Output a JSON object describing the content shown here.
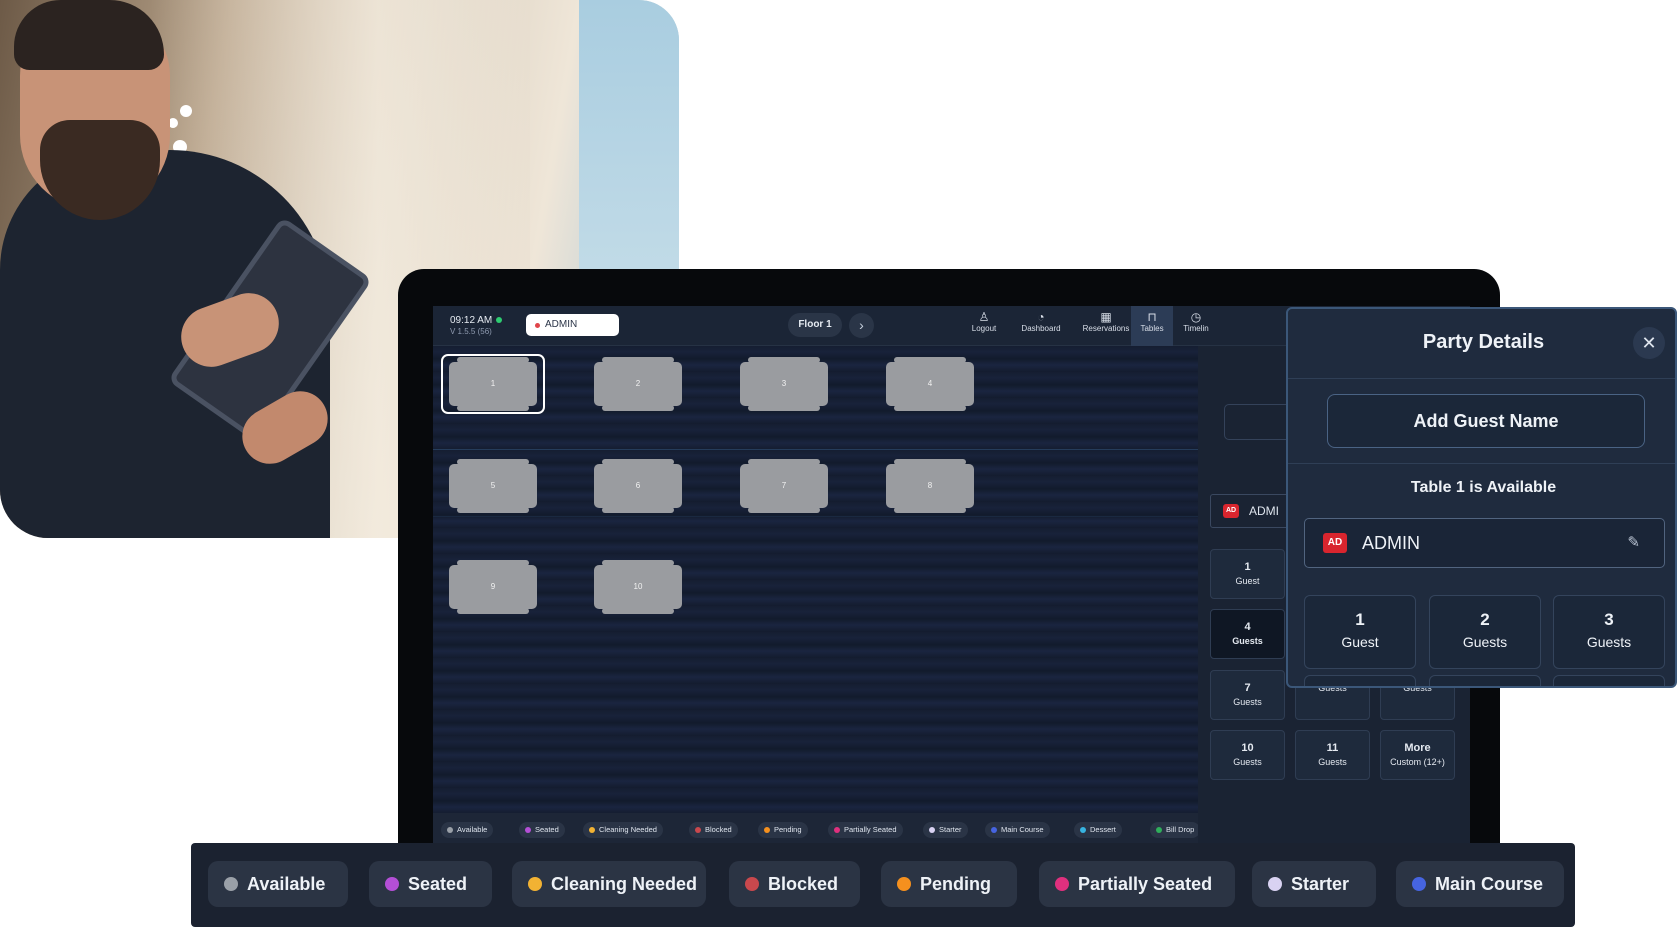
{
  "topbar": {
    "time": "09:12 AM",
    "version": "V 1.5.5 (56)",
    "user": "ADMIN",
    "floor": "Floor 1",
    "nav": [
      {
        "label": "Logout",
        "icon": "user-icon"
      },
      {
        "label": "Dashboard",
        "icon": "dashboard-icon"
      },
      {
        "label": "Reservations",
        "icon": "reservations-icon"
      },
      {
        "label": "Tables",
        "icon": "tables-icon"
      },
      {
        "label": "Timelin",
        "icon": "clock-icon"
      }
    ]
  },
  "tables": [
    {
      "label": "1",
      "status": "selected"
    },
    {
      "label": "2"
    },
    {
      "label": "3"
    },
    {
      "label": "4"
    },
    {
      "label": "5"
    },
    {
      "label": "6"
    },
    {
      "label": "7"
    },
    {
      "label": "8"
    },
    {
      "label": "9"
    },
    {
      "label": "10"
    }
  ],
  "mini_legend": [
    "Available",
    "Seated",
    "Cleaning Needed",
    "Blocked",
    "Pending",
    "Partially Seated",
    "Starter",
    "Main Course",
    "Dessert",
    "Bill Drop"
  ],
  "side_panel": {
    "staff": "ADMI",
    "staff_badge": "AD",
    "guest_options": [
      {
        "n": "1",
        "label": "Guest"
      },
      {
        "n": "4",
        "label": "Guests"
      },
      {
        "n": "7",
        "label": "Guests"
      },
      {
        "n": "",
        "label": "Guests"
      },
      {
        "n": "",
        "label": "Guests"
      },
      {
        "n": "10",
        "label": "Guests"
      },
      {
        "n": "11",
        "label": "Guests"
      },
      {
        "n": "More",
        "label": "Custom (12+)"
      }
    ]
  },
  "party": {
    "title": "Party Details",
    "close_icon": "close-icon",
    "add_guest": "Add Guest Name",
    "status": "Table 1 is Available",
    "staff_badge": "AD",
    "staff_name": "ADMIN",
    "edit_icon": "pencil-icon",
    "guests": [
      {
        "n": "1",
        "label": "Guest"
      },
      {
        "n": "2",
        "label": "Guests"
      },
      {
        "n": "3",
        "label": "Guests"
      }
    ]
  },
  "legend": [
    {
      "label": "Available",
      "color": "#9aa0a8"
    },
    {
      "label": "Seated",
      "color": "#b44fd6"
    },
    {
      "label": "Cleaning Needed",
      "color": "#f2b233"
    },
    {
      "label": "Blocked",
      "color": "#c9484d"
    },
    {
      "label": "Pending",
      "color": "#f5901e"
    },
    {
      "label": "Partially Seated",
      "color": "#e0307e"
    },
    {
      "label": "Starter",
      "color": "#d9d2f2"
    },
    {
      "label": "Main Course",
      "color": "#4664e0"
    }
  ],
  "mini_legend_colors": [
    "#9aa0a8",
    "#b44fd6",
    "#f2b233",
    "#c9484d",
    "#f5901e",
    "#e0307e",
    "#d9d2f2",
    "#4664e0",
    "#37b3e0",
    "#2fae5b"
  ]
}
